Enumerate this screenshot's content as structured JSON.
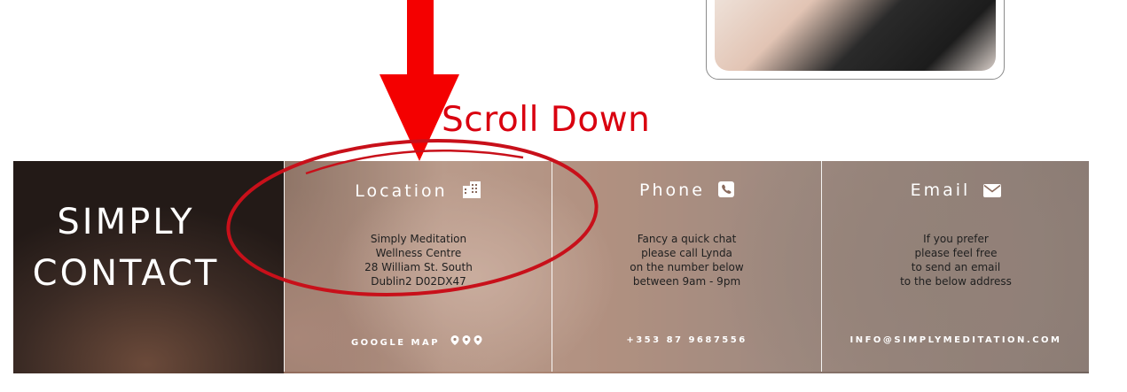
{
  "annotation": {
    "scroll_label": "Scroll Down"
  },
  "contact": {
    "title_line1": "SIMPLY",
    "title_line2": "CONTACT",
    "location": {
      "heading": "Location",
      "lines": [
        "Simply Meditation",
        "Wellness Centre",
        "28 William St. South",
        "Dublin2 D02DX47"
      ],
      "link": "GOOGLE MAP",
      "icon": "building-icon"
    },
    "phone": {
      "heading": "Phone",
      "lines": [
        "Fancy a quick chat",
        "please call Lynda",
        "on the number below",
        "between 9am - 9pm"
      ],
      "link": "+353 87 9687556",
      "icon": "phone-icon"
    },
    "email": {
      "heading": "Email",
      "lines": [
        "If you prefer",
        "please feel free",
        "to send an email",
        "to the below address"
      ],
      "link": "INFO@SIMPLYMEDITATION.COM",
      "icon": "envelope-icon"
    }
  },
  "colors": {
    "annotation_red": "#f40000",
    "label_red": "#d9000f"
  }
}
